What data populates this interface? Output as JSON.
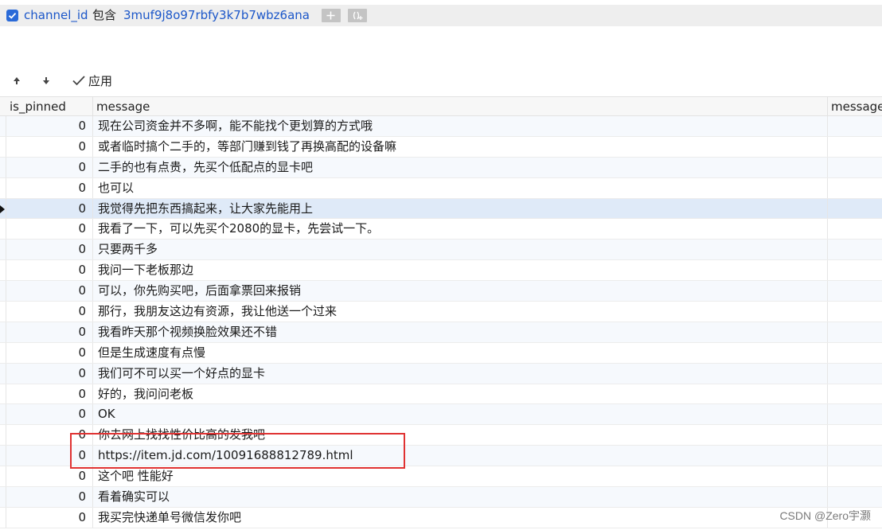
{
  "filter": {
    "field": "channel_id",
    "operator": "包含",
    "value": "3muf9j8o97rbfy3k7b7wbz6ana"
  },
  "toolbar": {
    "apply_label": "应用"
  },
  "columns": {
    "is_pinned": "is_pinned",
    "message": "message",
    "message2": "message"
  },
  "rows": [
    {
      "is_pinned": "0",
      "message": "现在公司资金并不多啊，能不能找个更划算的方式哦"
    },
    {
      "is_pinned": "0",
      "message": "或者临时搞个二手的，等部门赚到钱了再换高配的设备嘛"
    },
    {
      "is_pinned": "0",
      "message": "二手的也有点贵，先买个低配点的显卡吧"
    },
    {
      "is_pinned": "0",
      "message": "也可以"
    },
    {
      "is_pinned": "0",
      "message": "我觉得先把东西搞起来，让大家先能用上"
    },
    {
      "is_pinned": "0",
      "message": "我看了一下，可以先买个2080的显卡，先尝试一下。"
    },
    {
      "is_pinned": "0",
      "message": "只要两千多"
    },
    {
      "is_pinned": "0",
      "message": "我问一下老板那边"
    },
    {
      "is_pinned": "0",
      "message": "可以，你先购买吧，后面拿票回来报销"
    },
    {
      "is_pinned": "0",
      "message": "那行，我朋友这边有资源，我让他送一个过来"
    },
    {
      "is_pinned": "0",
      "message": "我看昨天那个视频换脸效果还不错"
    },
    {
      "is_pinned": "0",
      "message": "但是生成速度有点慢"
    },
    {
      "is_pinned": "0",
      "message": "我们可不可以买一个好点的显卡"
    },
    {
      "is_pinned": "0",
      "message": "好的，我问问老板"
    },
    {
      "is_pinned": "0",
      "message": "OK"
    },
    {
      "is_pinned": "0",
      "message": "你去网上找找性价比高的发我吧"
    },
    {
      "is_pinned": "0",
      "message": "https://item.jd.com/10091688812789.html"
    },
    {
      "is_pinned": "0",
      "message": "这个吧 性能好"
    },
    {
      "is_pinned": "0",
      "message": "看着确实可以"
    },
    {
      "is_pinned": "0",
      "message": "我买完快递单号微信发你吧"
    }
  ],
  "selected_row_index": 4,
  "watermark": "CSDN @Zero宇灏",
  "colors": {
    "accent": "#1c57c9",
    "checkbox": "#2a6ad8",
    "selected_row": "#dfeaf8",
    "highlight_box": "#e03232"
  }
}
